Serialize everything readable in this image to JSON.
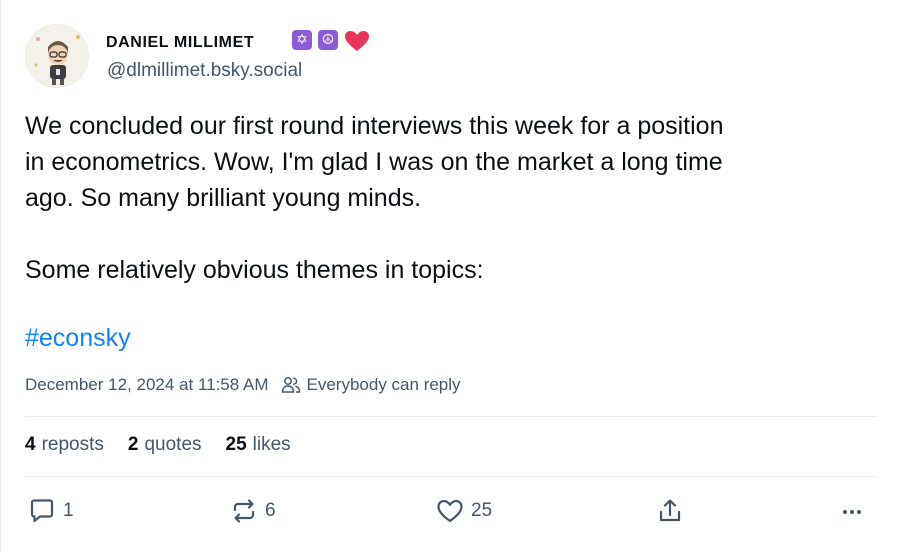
{
  "author": {
    "display_name": "DANIEL MILLIMET",
    "handle": "@dlmillimet.bsky.social",
    "badges": [
      "✡",
      "☮",
      "heart"
    ]
  },
  "post": {
    "lines_para1": [
      "We concluded our first round interviews this week for a position",
      "in econometrics. Wow, I'm glad I was on the market a long time",
      "ago. So many brilliant young minds."
    ],
    "line_para2": "Some relatively obvious themes in topics:",
    "hashtag": "#econsky"
  },
  "meta": {
    "timestamp": "December 12, 2024 at 11:58 AM",
    "reply_setting": "Everybody can reply"
  },
  "stats": {
    "reposts_count": "4",
    "reposts_label": "reposts",
    "quotes_count": "2",
    "quotes_label": "quotes",
    "likes_count": "25",
    "likes_label": "likes"
  },
  "actions": {
    "reply_count": "1",
    "repost_count": "6",
    "like_count": "25"
  },
  "colors": {
    "link": "#1083fe",
    "muted": "#42576c",
    "badge": "#8e5bd6",
    "heart": "#e8355a"
  }
}
